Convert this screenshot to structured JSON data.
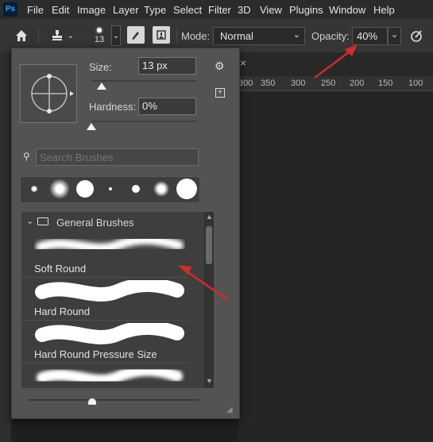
{
  "menu": {
    "logo": "Ps",
    "items": [
      "File",
      "Edit",
      "Image",
      "Layer",
      "Type",
      "Select",
      "Filter",
      "3D",
      "View",
      "Plugins",
      "Window",
      "Help"
    ]
  },
  "options": {
    "brush_size": "13",
    "mode_label": "Mode:",
    "mode_value": "Normal",
    "opacity_label": "Opacity:",
    "opacity_value": "40%"
  },
  "ruler": {
    "marks": [
      "300",
      "350",
      "300",
      "250",
      "200",
      "150",
      "100"
    ]
  },
  "panel": {
    "size_label": "Size:",
    "size_value": "13 px",
    "size_fraction": 0.1,
    "hardness_label": "Hardness:",
    "hardness_value": "0%",
    "hardness_fraction": 0.0,
    "search_placeholder": "Search Brushes",
    "group_name": "General Brushes",
    "brushes": [
      "Soft Round",
      "Hard Round",
      "Hard Round Pressure Size"
    ]
  },
  "colors": {
    "annotation_arrow": "#d42a2a",
    "accent": "#31a8ff"
  }
}
